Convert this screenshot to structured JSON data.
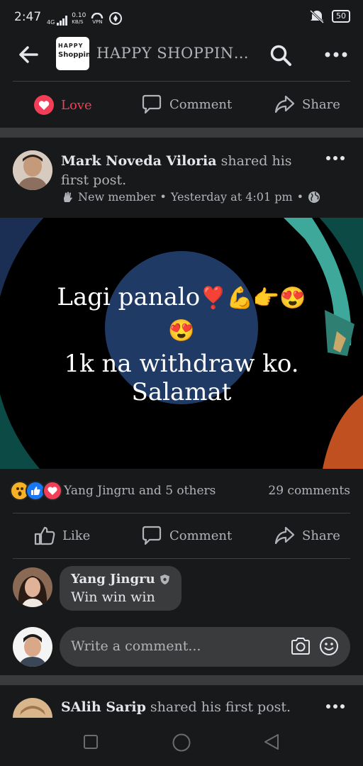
{
  "status_bar": {
    "time": "2:47",
    "network": "4G",
    "speed_value": "0.10",
    "speed_unit": "KB/S",
    "vpn": "VPN",
    "battery": "50"
  },
  "header": {
    "group_title": "HAPPY SHOPPIN…",
    "logo_line1": "HAPPY",
    "logo_line2": "Shopping"
  },
  "prev_post_actions": {
    "love": "Love",
    "comment": "Comment",
    "share": "Share"
  },
  "post": {
    "author": "Mark Noveda Viloria",
    "action_text": " shared his first post.",
    "badge": "New member",
    "sep1": "•",
    "time": "Yesterday at 4:01 pm",
    "sep2": "•",
    "image_text_line1": "Lagi panalo",
    "image_text_line2": "1k na withdraw ko.",
    "image_text_line3": "Salamat",
    "emoji_heart": "❣️",
    "emoji_muscle": "💪",
    "emoji_point": "👉",
    "emoji_love_eyes": "😍",
    "reactions_text": "Yang Jingru and 5 others",
    "comments_count": "29 comments",
    "actions": {
      "like": "Like",
      "comment": "Comment",
      "share": "Share"
    }
  },
  "top_comment": {
    "author": "Yang Jingru",
    "text": "Win win win"
  },
  "comment_input": {
    "placeholder": "Write a comment..."
  },
  "next_post": {
    "author": "SAlih Sarip",
    "action_text": " shared his first post."
  },
  "colors": {
    "background": "#18191a",
    "love_red": "#f33e58",
    "like_blue": "#1877f2",
    "reaction_wow": "#f7b125"
  }
}
